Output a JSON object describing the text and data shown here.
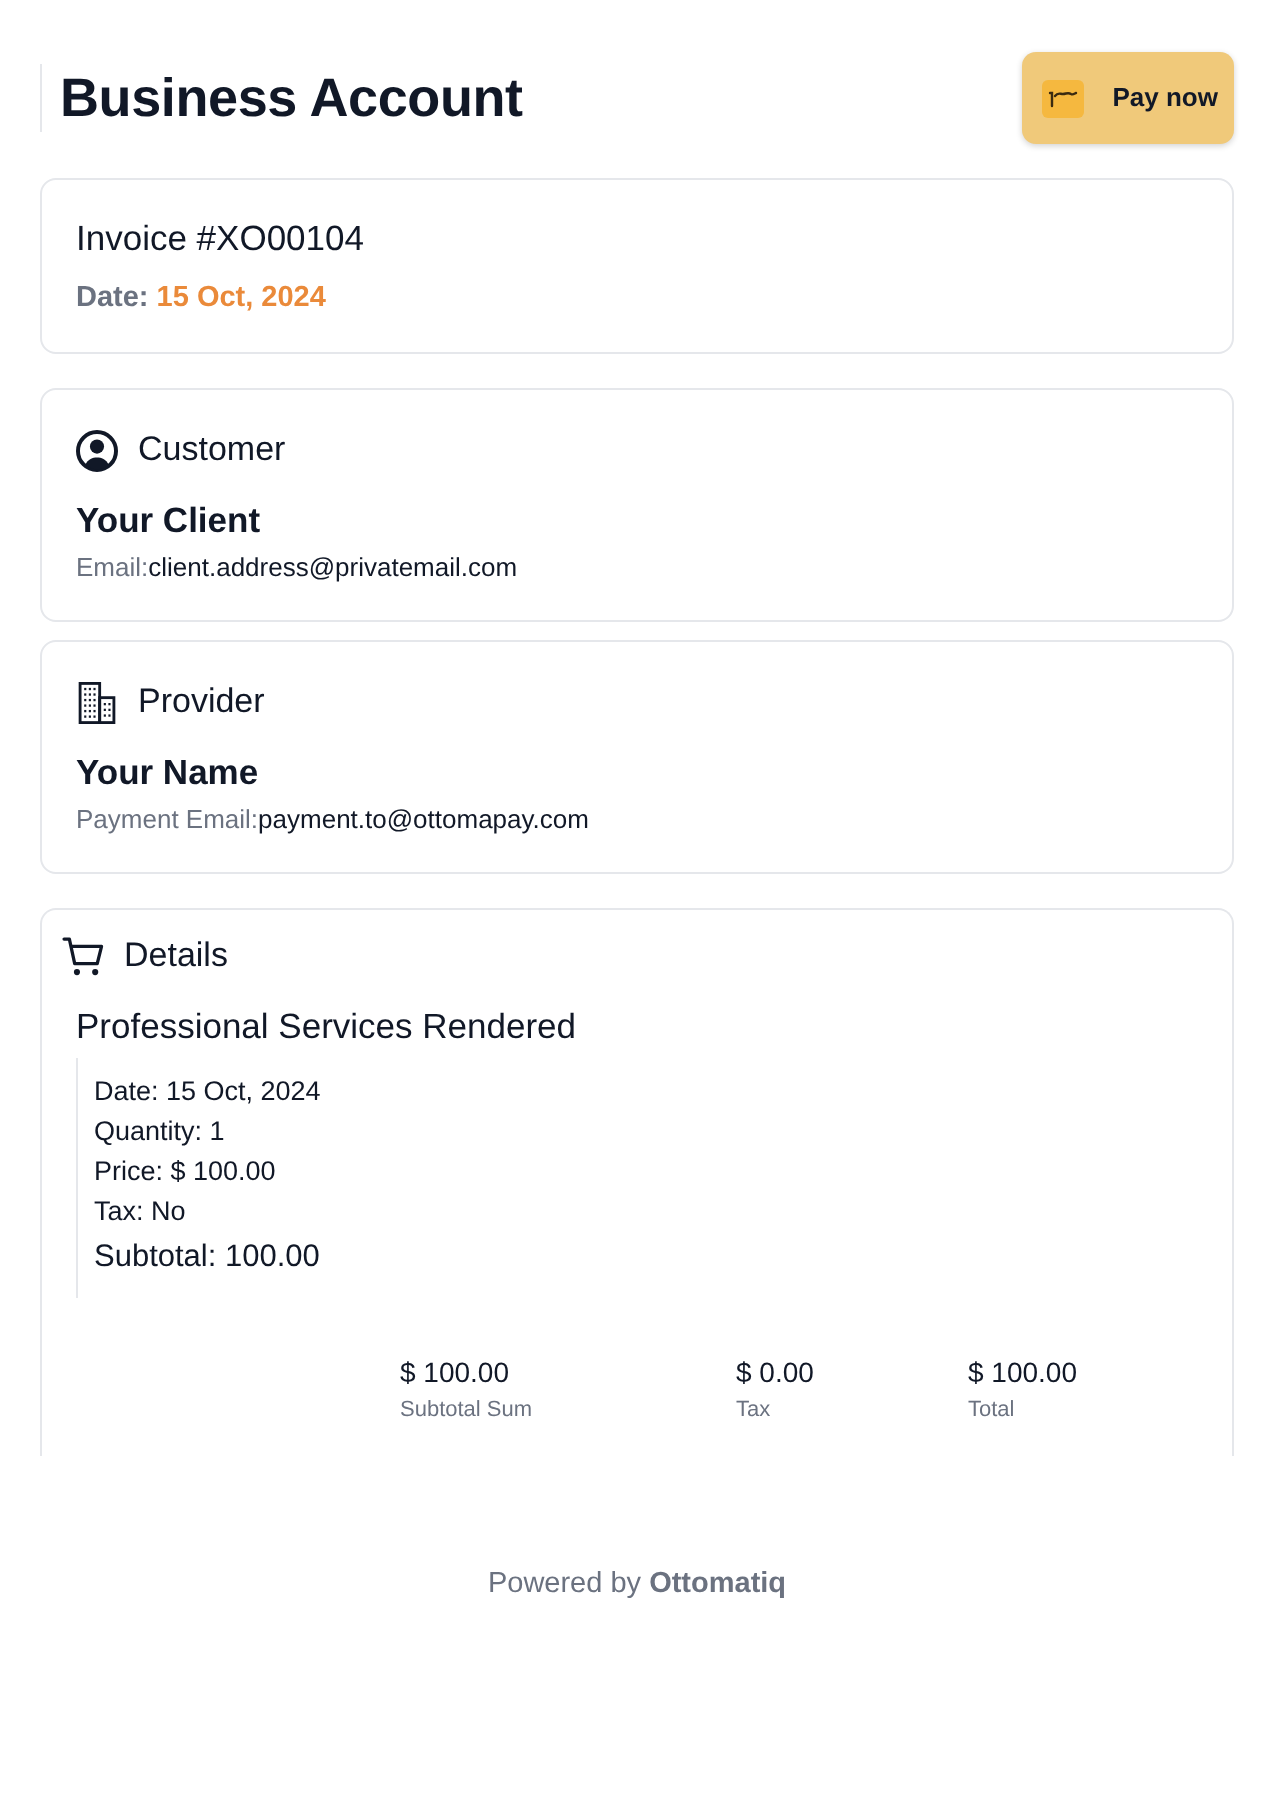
{
  "header": {
    "title": "Business Account",
    "pay_button": {
      "label": "Pay now"
    }
  },
  "invoice": {
    "title": "Invoice #XO00104",
    "date_label": "Date:",
    "date": "15 Oct, 2024"
  },
  "parties": [
    {
      "kind": "customer",
      "heading": "Customer",
      "name": "Your Client",
      "email_label": "Email:",
      "email": "client.address@privatemail.com"
    },
    {
      "kind": "provider",
      "heading": "Provider",
      "name": "Your Name",
      "email_label": "Payment Email:",
      "email": "payment.to@ottomapay.com"
    }
  ],
  "details": {
    "heading": "Details",
    "items": [
      {
        "title": "Professional Services Rendered",
        "lines": [
          "Date: 15 Oct, 2024",
          "Quantity: 1",
          "Price: $ 100.00",
          "Tax: No"
        ],
        "subtotal": "Subtotal: 100.00"
      }
    ],
    "totals": [
      {
        "value": "$ 100.00",
        "label": "Subtotal Sum"
      },
      {
        "value": "$ 0.00",
        "label": "Tax"
      },
      {
        "value": "$ 100.00",
        "label": "Total"
      }
    ]
  },
  "footer": {
    "text": "Powered by **Ottomatiq**"
  }
}
